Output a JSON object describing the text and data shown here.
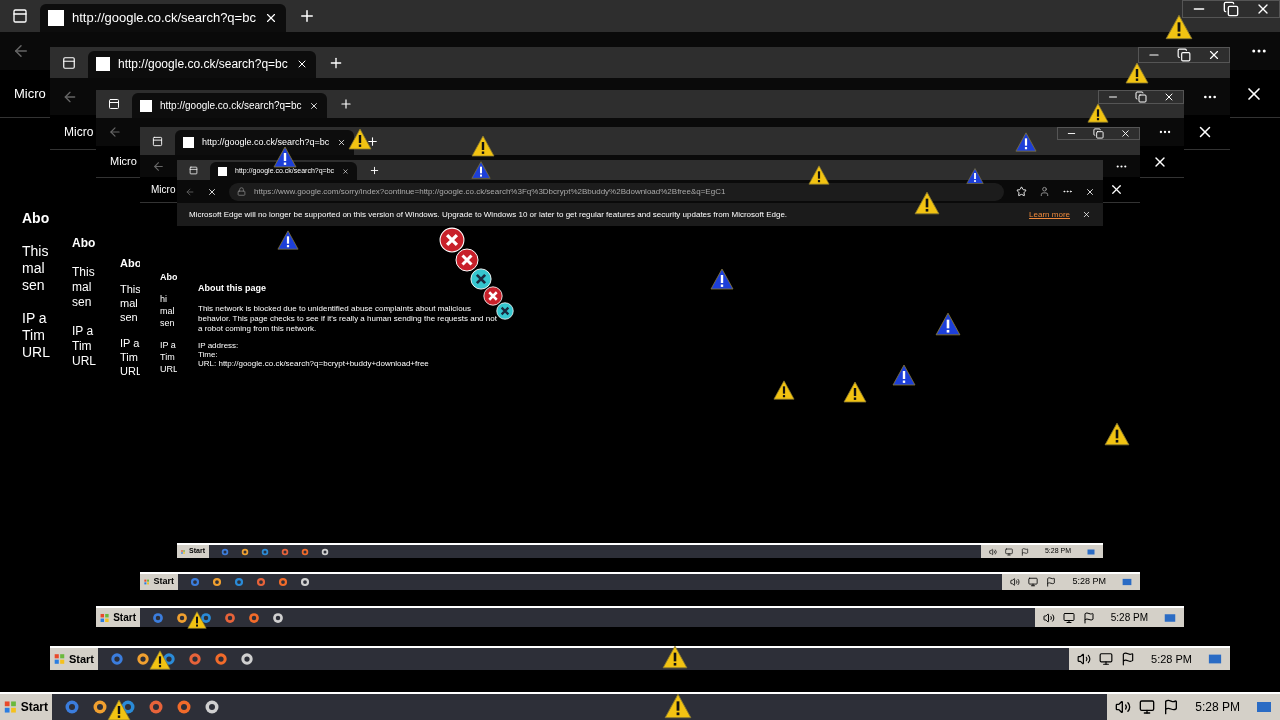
{
  "windows": [
    {
      "tab_title": "http://google.co.ck/search?q=bc",
      "edge_label": "Micro",
      "page": {
        "heading": "Abo",
        "paragraph": [
          "This",
          "mal",
          "sen"
        ],
        "details": [
          "IP a",
          "Tim",
          "URL"
        ]
      }
    },
    {
      "tab_title": "http://google.co.ck/search?q=bc",
      "edge_label": "Micro",
      "page": {
        "heading": "Abo",
        "paragraph": [
          "This",
          "mal",
          "sen"
        ],
        "details": [
          "IP a",
          "Tim",
          "URL"
        ]
      }
    },
    {
      "tab_title": "http://google.co.ck/search?q=bc",
      "edge_label": "Micro",
      "page": {
        "heading": "Abo",
        "paragraph": [
          "This",
          "mal",
          "sen"
        ],
        "details": [
          "IP a",
          "Tim",
          "URL"
        ]
      }
    },
    {
      "tab_title": "http://google.co.ck/search?q=bc",
      "edge_label": "Micro",
      "page": {
        "heading": "Abo",
        "paragraph": [
          "hi",
          "mal",
          "sen"
        ],
        "details": [
          "IP a",
          "Tim",
          "URL"
        ]
      }
    }
  ],
  "innermost": {
    "tab_title": "http://google.co.ck/search?q=bc",
    "address": "https://www.google.com/sorry/index?continue=http://google.co.ck/search%3Fq%3Dbcrypt%2Bbuddy%2Bdownload%2Bfree&q=EgC1",
    "infobar": {
      "text": "Microsoft Edge will no longer be supported on this version of Windows. Upgrade to Windows 10 or later to get regular features and security updates from Microsoft Edge.",
      "link": "Learn more"
    },
    "page": {
      "heading": "About this page",
      "paragraph": "This network is blocked due to unidentified abuse complaints about malicious behavior. This page checks to see if it's really a human sending the requests and not a robot coming from this network.",
      "details": [
        "IP address:",
        "Time:",
        "URL: http://google.co.ck/search?q=bcrypt+buddy+download+free"
      ]
    }
  },
  "taskbars": [
    {
      "start": "Start",
      "clock": "5:28 PM"
    },
    {
      "start": "Start",
      "clock": "5:28 PM"
    },
    {
      "start": "Start",
      "clock": "5:28 PM"
    },
    {
      "start": "Start",
      "clock": "5:28 PM"
    },
    {
      "start": "Start",
      "clock": "5:28 PM"
    }
  ]
}
